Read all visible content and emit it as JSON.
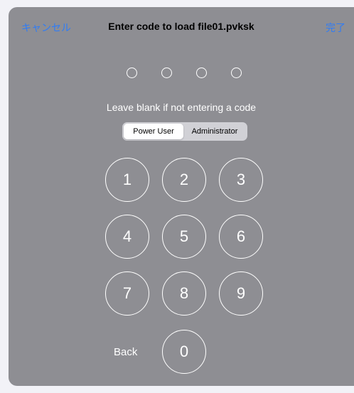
{
  "nav": {
    "cancel_label": "キャンセル",
    "title": "Enter code to load file01.pvksk",
    "done_label": "完了"
  },
  "hint": "Leave blank if not entering a code",
  "segments": [
    "Power User",
    "Administrator"
  ],
  "selected_segment": "Power User",
  "keys": [
    "1",
    "2",
    "3",
    "4",
    "5",
    "6",
    "7",
    "8",
    "9",
    "0"
  ],
  "back_label": "Back",
  "colors": {
    "accent": "#2f7cf6",
    "sheet": "#8e8e93"
  }
}
